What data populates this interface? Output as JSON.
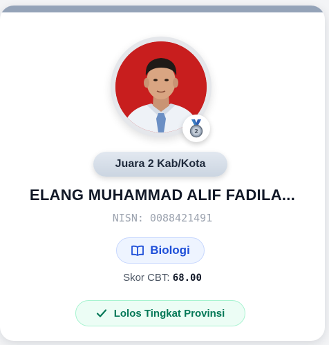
{
  "card": {
    "rank_label": "Juara 2 Kab/Kota",
    "student_name": "ELANG MUHAMMAD ALIF FADILA...",
    "nisn": "NISN: 0088421491",
    "subject": {
      "label": "Biologi",
      "icon": "book-open-icon"
    },
    "score": {
      "label": "Skor CBT:",
      "value": "68.00"
    },
    "status": {
      "label": "Lolos Tingkat Provinsi",
      "icon": "check-icon"
    },
    "medal_icon": "medal-icon",
    "medal_number": "2"
  },
  "colors": {
    "accent_blue": "#1d4ed8",
    "success_green": "#047857",
    "photo_background": "#c81e1e",
    "topbar": "#94a3b8"
  }
}
